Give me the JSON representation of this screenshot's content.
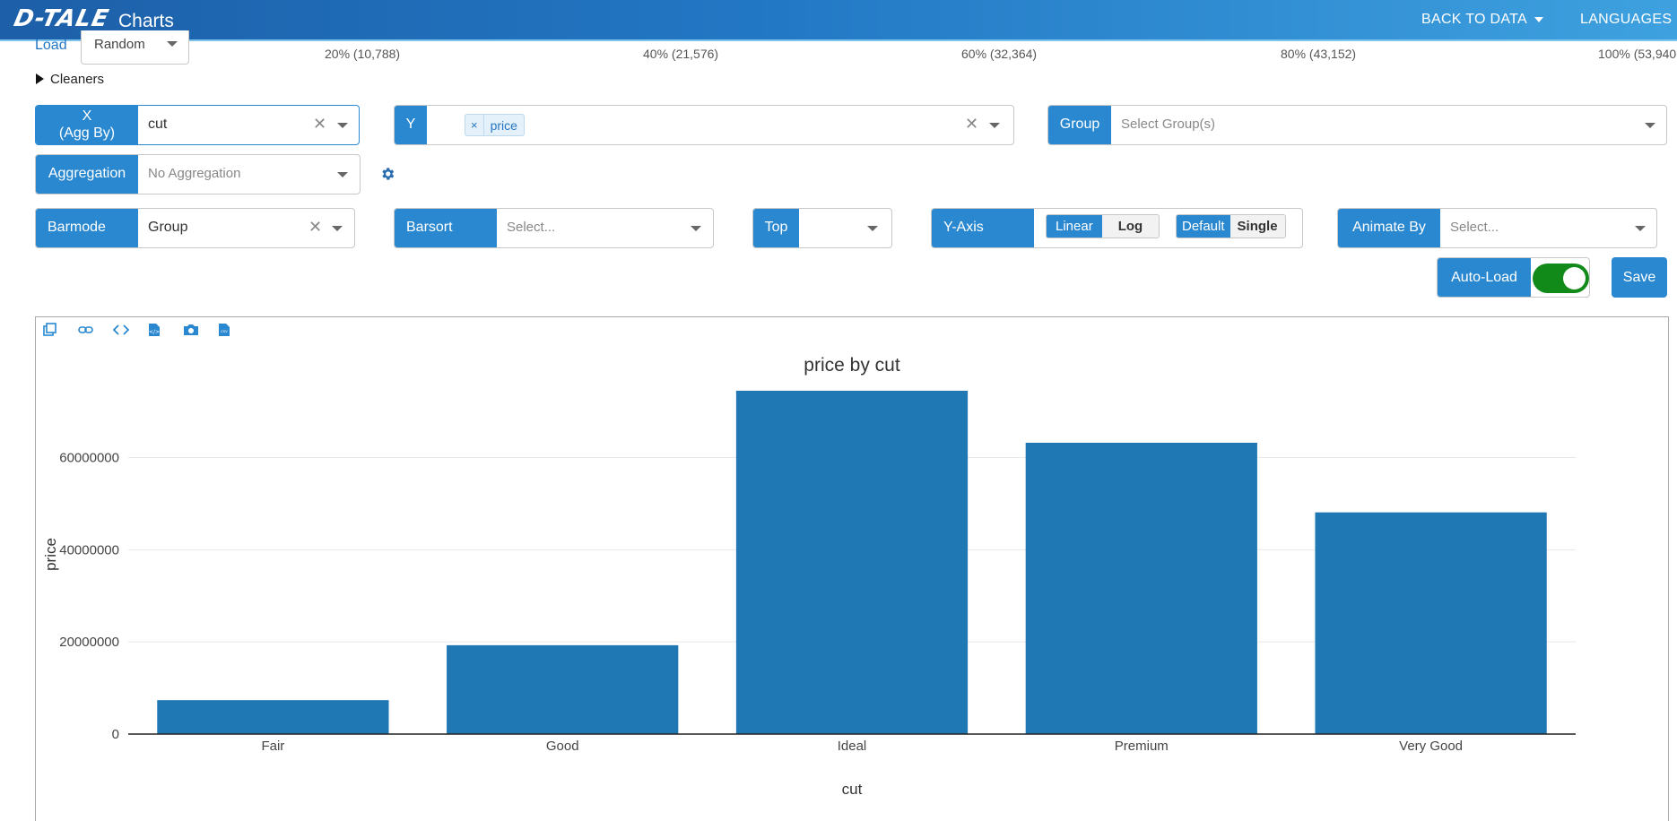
{
  "header": {
    "logo": "D-TALE",
    "title": "Charts",
    "back_to_data": "BACK TO DATA",
    "languages": "LANGUAGES"
  },
  "load": {
    "label": "Load",
    "value": "Random",
    "percentages": [
      "20% (10,788)",
      "40% (21,576)",
      "60% (32,364)",
      "80% (43,152)",
      "100% (53,940"
    ]
  },
  "cleaners": {
    "label": "Cleaners"
  },
  "controls": {
    "x": {
      "label_line1": "X",
      "label_line2": "(Agg By)",
      "value": "cut"
    },
    "y": {
      "label": "Y",
      "tags": [
        "price"
      ]
    },
    "group": {
      "label": "Group",
      "placeholder": "Select Group(s)"
    },
    "aggregation": {
      "label": "Aggregation",
      "placeholder": "No Aggregation"
    },
    "barmode": {
      "label": "Barmode",
      "value": "Group"
    },
    "barsort": {
      "label": "Barsort",
      "placeholder": "Select..."
    },
    "top": {
      "label": "Top",
      "value": ""
    },
    "y_axis": {
      "label": "Y-Axis",
      "scale_options": [
        "Linear",
        "Log"
      ],
      "selected_scale": "Linear",
      "mode_options": [
        "Default",
        "Single"
      ],
      "selected_mode": "Default"
    },
    "animate_by": {
      "label": "Animate By",
      "placeholder": "Select..."
    },
    "auto_load": {
      "label": "Auto-Load",
      "enabled": true
    },
    "save": {
      "label": "Save"
    }
  },
  "chart_toolbar": [
    "popup-icon",
    "link-icon",
    "code-icon",
    "export-html-icon",
    "camera-icon",
    "csv-icon"
  ],
  "colors": {
    "accent": "#2a88d0",
    "bar": "#1f77b4",
    "toggle_on": "#128a1a"
  },
  "chart_data": {
    "type": "bar",
    "title": "price by cut",
    "xlabel": "cut",
    "ylabel": "price",
    "categories": [
      "Fair",
      "Good",
      "Ideal",
      "Premium",
      "Very Good"
    ],
    "series": [
      {
        "values": [
          7360000,
          19280000,
          74510000,
          63220000,
          48110000
        ]
      }
    ],
    "yticks": [
      0,
      20000000,
      40000000,
      60000000
    ],
    "ytick_labels": [
      "0",
      "20000000",
      "40000000",
      "60000000"
    ],
    "ylim": [
      0,
      78000000
    ],
    "grid": true
  }
}
